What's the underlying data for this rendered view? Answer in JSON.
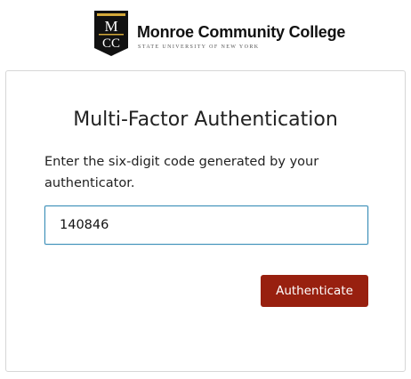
{
  "header": {
    "logo_monogram": "MCC",
    "logo_name": "Monroe Community College",
    "logo_subtitle": "STATE UNIVERSITY OF NEW YORK"
  },
  "mfa": {
    "title": "Multi-Factor Authentication",
    "instructions": "Enter the six-digit code generated by your authenticator.",
    "code_value": "140846",
    "submit_label": "Authenticate"
  },
  "colors": {
    "button_background": "#98200f",
    "logo_gold": "#d4a93a",
    "input_focus_border": "#3c8fb8"
  }
}
